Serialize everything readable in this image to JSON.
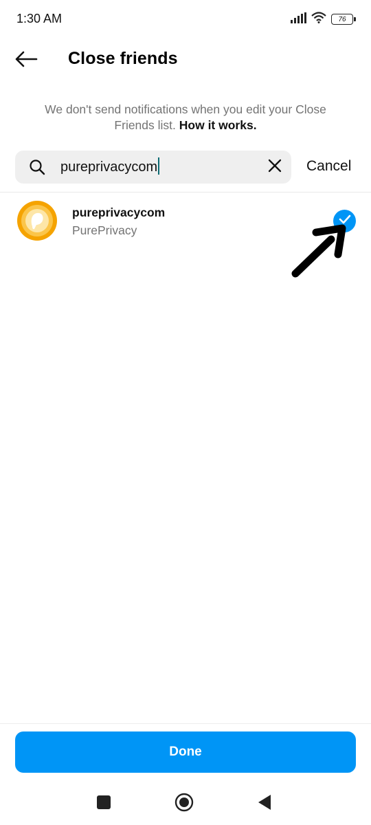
{
  "status_bar": {
    "time": "1:30 AM",
    "battery": "76",
    "icons": [
      "signal-icon",
      "wifi-icon",
      "battery-icon"
    ]
  },
  "header": {
    "title": "Close friends",
    "back_icon": "arrow-left-icon"
  },
  "info": {
    "text": "We don't send notifications when you edit your Close Friends list.",
    "link": "How it works."
  },
  "search": {
    "value": "pureprivacycom",
    "placeholder": "Search",
    "cancel_label": "Cancel"
  },
  "results": [
    {
      "username": "pureprivacycom",
      "full_name": "PurePrivacy",
      "selected": true
    }
  ],
  "footer": {
    "done_label": "Done"
  },
  "colors": {
    "accent": "#0095f6",
    "secondary_text": "#737373",
    "search_bg": "#efefef",
    "avatar_outer": "#f5a300"
  }
}
